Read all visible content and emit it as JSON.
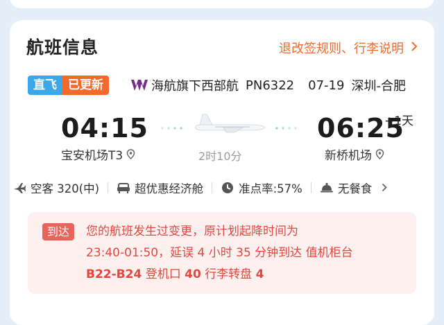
{
  "section": {
    "title": "航班信息",
    "rules_link": "退改签规则、行李说明"
  },
  "tags": {
    "direct": "直飞",
    "updated": "已更新"
  },
  "flight": {
    "airline": "海航旗下西部航",
    "number": "PN6322",
    "date": "07-19",
    "route": "深圳-合肥",
    "dep_time": "04:15",
    "arr_time": "06:25",
    "plus_day": "+1天",
    "dep_airport": "宝安机场T3",
    "arr_airport": "新桥机场",
    "duration": "2时10分"
  },
  "info": {
    "aircraft": "空客 320(中)",
    "cabin": "超优惠经济舱",
    "on_time": "准点率:57%",
    "meal": "无餐食"
  },
  "notice": {
    "badge": "到达",
    "line1": "您的航班发生过变更，原计划起降时间为",
    "line2": "23:40-01:50，延误 4 小时 35 分钟到达 值机柜台",
    "counter": "B22-B24",
    "gate_label": "登机口",
    "gate": "40",
    "carousel_label": "行李转盘",
    "carousel": "4"
  },
  "colors": {
    "accent": "#f26a2b",
    "direct": "#3aa7e8",
    "notice_text": "#e2473f",
    "notice_bg": "#fdf0ef"
  }
}
